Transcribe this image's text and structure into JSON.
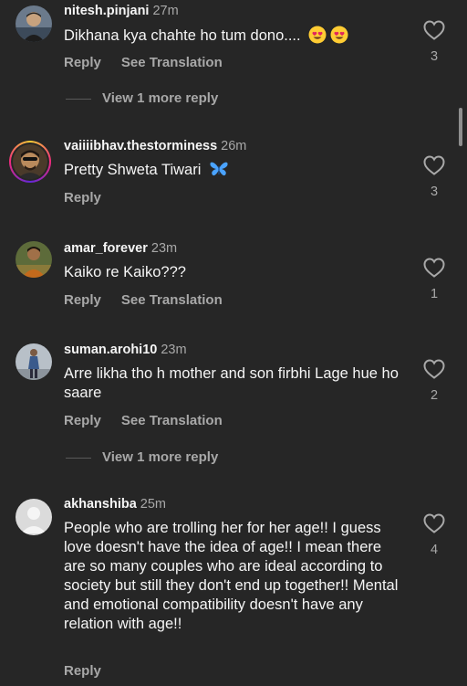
{
  "comments": [
    {
      "username": "nitesh.pinjani",
      "time": "27m",
      "text": "Dikhana kya chahte ho tum dono....",
      "emoji": "heart-eyes-emoji x2",
      "reply_label": "Reply",
      "translate_label": "See Translation",
      "likes": "3",
      "more_replies": "View 1 more reply"
    },
    {
      "username": "vaiiiibhav.thestorminess",
      "time": "26m",
      "text": "Pretty Shweta Tiwari",
      "emoji": "blue-butterfly-emoji",
      "reply_label": "Reply",
      "likes": "3"
    },
    {
      "username": "amar_forever",
      "time": "23m",
      "text": "Kaiko re Kaiko???",
      "reply_label": "Reply",
      "translate_label": "See Translation",
      "likes": "1"
    },
    {
      "username": "suman.arohi10",
      "time": "23m",
      "text": "Arre likha tho h mother and son firbhi Lage hue ho saare",
      "reply_label": "Reply",
      "translate_label": "See Translation",
      "likes": "2",
      "more_replies": "View 1 more reply"
    },
    {
      "username": "akhanshiba",
      "time": "25m",
      "text": "People who are trolling her for her age!! I guess love doesn't have the idea of age!! I mean there are so many couples who are ideal according to society but still they don't end up together!! Mental and emotional compatibility doesn't have any relation with age!!",
      "reply_label": "Reply",
      "likes": "4"
    }
  ],
  "colors": {
    "background": "#262626",
    "primary_text": "#f5f5f5",
    "secondary_text": "#a8a8a8"
  },
  "icons": [
    "heart-outline-icon",
    "avatar-icon",
    "story-ring"
  ]
}
